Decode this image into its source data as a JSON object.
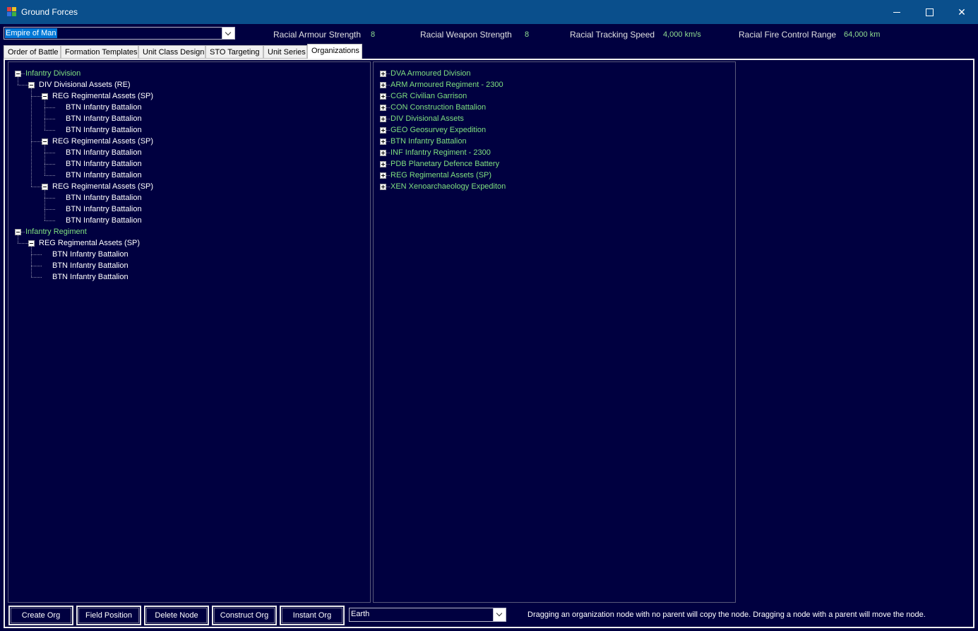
{
  "window": {
    "title": "Ground Forces"
  },
  "race_select": {
    "value": "Empire of Man"
  },
  "stats": [
    {
      "label": "Racial Armour Strength",
      "value": "8"
    },
    {
      "label": "Racial Weapon Strength",
      "value": "8"
    },
    {
      "label": "Racial Tracking Speed",
      "value": "4,000 km/s"
    },
    {
      "label": "Racial Fire Control Range",
      "value": "64,000 km"
    }
  ],
  "tabs": [
    {
      "label": "Order of Battle"
    },
    {
      "label": "Formation Templates"
    },
    {
      "label": "Unit Class Design"
    },
    {
      "label": "STO Targeting"
    },
    {
      "label": "Unit Series"
    },
    {
      "label": "Organizations",
      "active": true
    }
  ],
  "left_tree": [
    {
      "label": "Infantry Division",
      "level": 0,
      "toggle": "minus",
      "green": true
    },
    {
      "label": "DIV Divisional Assets  (RE)",
      "level": 1,
      "toggle": "minus"
    },
    {
      "label": "REG Regimental Assets  (SP)",
      "level": 2,
      "toggle": "minus"
    },
    {
      "label": "BTN Infantry Battalion",
      "level": 3
    },
    {
      "label": "BTN Infantry Battalion",
      "level": 3
    },
    {
      "label": "BTN Infantry Battalion",
      "level": 3
    },
    {
      "label": "REG Regimental Assets  (SP)",
      "level": 2,
      "toggle": "minus"
    },
    {
      "label": "BTN Infantry Battalion",
      "level": 3
    },
    {
      "label": "BTN Infantry Battalion",
      "level": 3
    },
    {
      "label": "BTN Infantry Battalion",
      "level": 3
    },
    {
      "label": "REG Regimental Assets  (SP)",
      "level": 2,
      "toggle": "minus"
    },
    {
      "label": "BTN Infantry Battalion",
      "level": 3
    },
    {
      "label": "BTN Infantry Battalion",
      "level": 3
    },
    {
      "label": "BTN Infantry Battalion",
      "level": 3
    },
    {
      "label": "Infantry Regiment",
      "level": 0,
      "toggle": "minus",
      "green": true
    },
    {
      "label": "REG Regimental Assets  (SP)",
      "level": 1,
      "toggle": "minus"
    },
    {
      "label": "BTN Infantry Battalion",
      "level": 2
    },
    {
      "label": "BTN Infantry Battalion",
      "level": 2
    },
    {
      "label": "BTN Infantry Battalion",
      "level": 2
    }
  ],
  "right_tree": [
    {
      "label": "DVA Armoured Division"
    },
    {
      "label": "ARM Armoured Regiment - 2300"
    },
    {
      "label": "CGR Civilian Garrison"
    },
    {
      "label": "CON Construction Battalion"
    },
    {
      "label": "DIV Divisional Assets"
    },
    {
      "label": "GEO Geosurvey Expedition"
    },
    {
      "label": "BTN Infantry Battalion"
    },
    {
      "label": "INF Infantry Regiment - 2300"
    },
    {
      "label": "PDB Planetary Defence Battery"
    },
    {
      "label": "REG Regimental Assets  (SP)"
    },
    {
      "label": "XEN Xenoarchaeology Expediton"
    }
  ],
  "buttons": {
    "create_org": "Create Org",
    "field_position": "Field Position",
    "delete_node": "Delete Node",
    "construct_org": "Construct Org",
    "instant_org": "Instant Org"
  },
  "location_select": {
    "value": "Earth"
  },
  "hint": "Dragging an organization node with no parent will copy the node. Dragging a node with a parent will move the node.",
  "icons": {
    "window": "app-icon",
    "minimize": "minimize-icon",
    "maximize": "maximize-icon",
    "close": "close-icon",
    "expand": "plus-icon",
    "collapse": "minus-icon"
  },
  "colors": {
    "background": "#000040",
    "titlebar": "#0a4f8c",
    "green_text": "#7fe07f",
    "stat_value": "#8fdc8f",
    "selection": "#0078d7"
  }
}
